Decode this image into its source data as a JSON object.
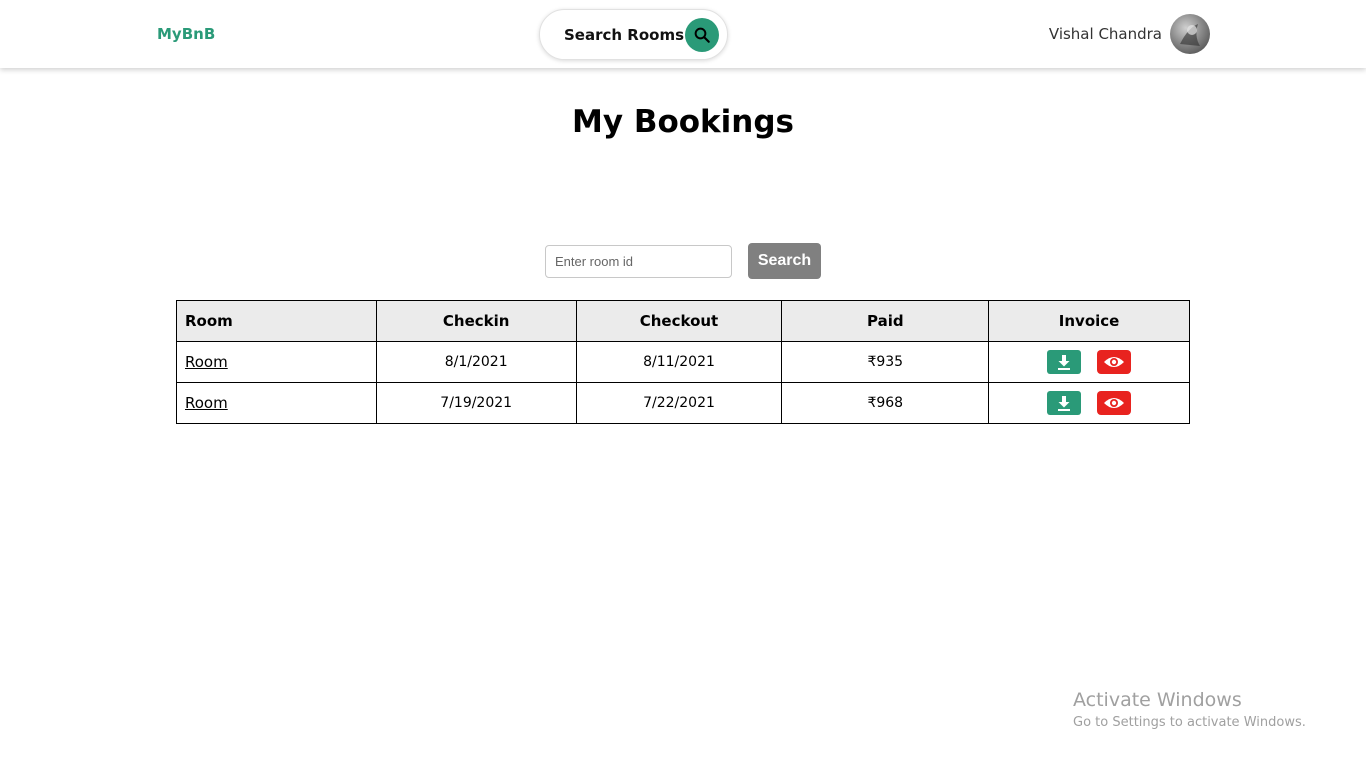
{
  "header": {
    "brand": "MyBnB",
    "search_label": "Search Rooms",
    "search_icon": "search-icon",
    "user_name": "Vishal Chandra"
  },
  "page": {
    "title": "My Bookings"
  },
  "room_search": {
    "placeholder": "Enter room id",
    "value": "",
    "button_label": "Search"
  },
  "table": {
    "columns": [
      "Room",
      "Checkin",
      "Checkout",
      "Paid",
      "Invoice"
    ],
    "rows": [
      {
        "room": "Room",
        "checkin": "8/1/2021",
        "checkout": "8/11/2021",
        "paid": "₹935"
      },
      {
        "room": "Room",
        "checkin": "7/19/2021",
        "checkout": "7/22/2021",
        "paid": "₹968"
      }
    ],
    "invoice_actions": {
      "download_icon": "download-icon",
      "view_icon": "eye-icon"
    }
  },
  "watermark": {
    "title": "Activate Windows",
    "subtitle": "Go to Settings to activate Windows."
  },
  "colors": {
    "brand": "#2a9a78",
    "download": "#2a9a78",
    "view": "#e8231f",
    "search_button": "#808080",
    "table_header_bg": "#ebebeb"
  }
}
